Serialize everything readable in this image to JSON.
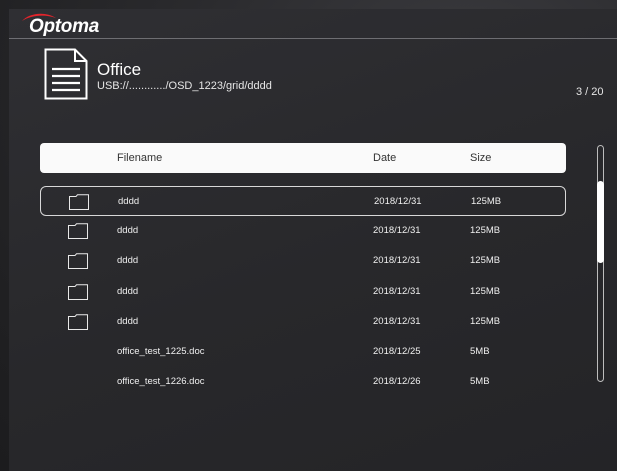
{
  "brand": {
    "logo_text": "Optoma",
    "accent_color": "#e3242b"
  },
  "folder": {
    "title": "Office",
    "path": "USB://............/OSD_1223/grid/dddd",
    "icon": "document-icon"
  },
  "pager": "3 / 20",
  "columns": {
    "name": "Filename",
    "date": "Date",
    "size": "Size"
  },
  "rows": [
    {
      "type": "folder",
      "name": "dddd",
      "date": "2018/12/31",
      "size": "125MB",
      "selected": true
    },
    {
      "type": "folder",
      "name": "dddd",
      "date": "2018/12/31",
      "size": "125MB"
    },
    {
      "type": "folder",
      "name": "dddd",
      "date": "2018/12/31",
      "size": "125MB"
    },
    {
      "type": "folder",
      "name": "dddd",
      "date": "2018/12/31",
      "size": "125MB"
    },
    {
      "type": "folder",
      "name": "dddd",
      "date": "2018/12/31",
      "size": "125MB"
    },
    {
      "type": "file",
      "name": "office_test_1225.doc",
      "date": "2018/12/25",
      "size": "5MB"
    },
    {
      "type": "file",
      "name": "office_test_1226.doc",
      "date": "2018/12/26",
      "size": "5MB"
    }
  ]
}
